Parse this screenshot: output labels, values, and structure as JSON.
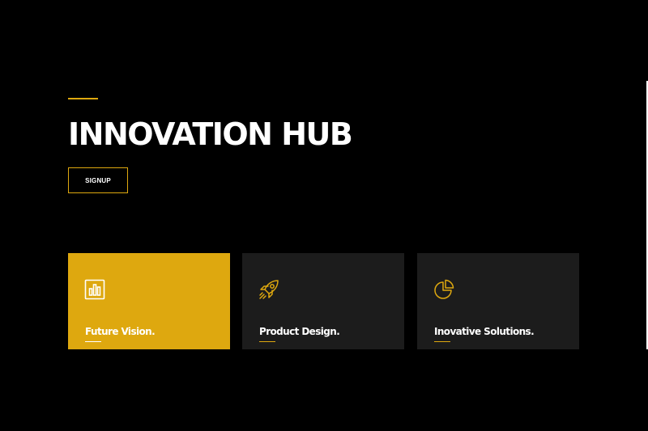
{
  "hero": {
    "title": "INNOVATION HUB",
    "signup_label": "SIGNUP"
  },
  "cards": [
    {
      "title": "Future Vision.",
      "icon": "bar-chart-icon",
      "active": true
    },
    {
      "title": "Product Design.",
      "icon": "rocket-icon",
      "active": false
    },
    {
      "title": "Inovative Solutions.",
      "icon": "pie-chart-icon",
      "active": false
    }
  ],
  "colors": {
    "background": "#000000",
    "accent": "#dea80f",
    "card": "#1c1c1c",
    "text": "#ffffff"
  }
}
